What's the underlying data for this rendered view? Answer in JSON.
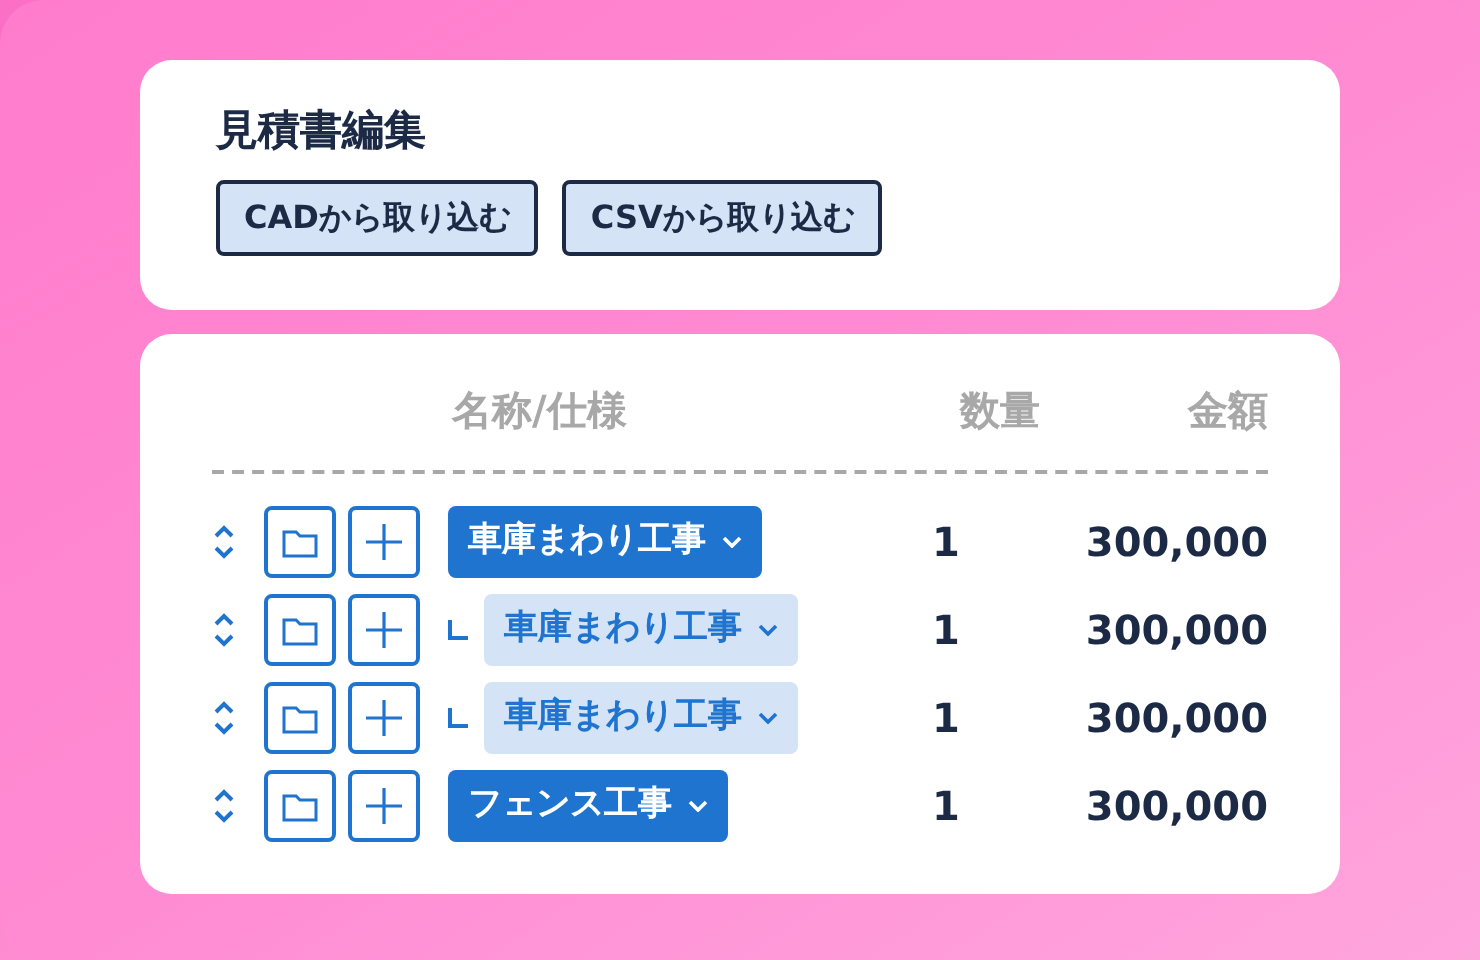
{
  "header": {
    "title": "見積書編集",
    "buttons": [
      "CADから取り込む",
      "CSVから取り込む"
    ]
  },
  "table": {
    "columns": [
      "名称/仕様",
      "数量",
      "金額"
    ],
    "rows": [
      {
        "name": "車庫まわり工事",
        "quantity": "1",
        "amount": "300,000",
        "children": [
          {
            "name": "車庫まわり工事",
            "quantity": "1",
            "amount": "300,000"
          },
          {
            "name": "車庫まわり工事",
            "quantity": "1",
            "amount": "300,000"
          }
        ]
      },
      {
        "name": "フェンス工事",
        "quantity": "1",
        "amount": "300,000"
      }
    ]
  }
}
